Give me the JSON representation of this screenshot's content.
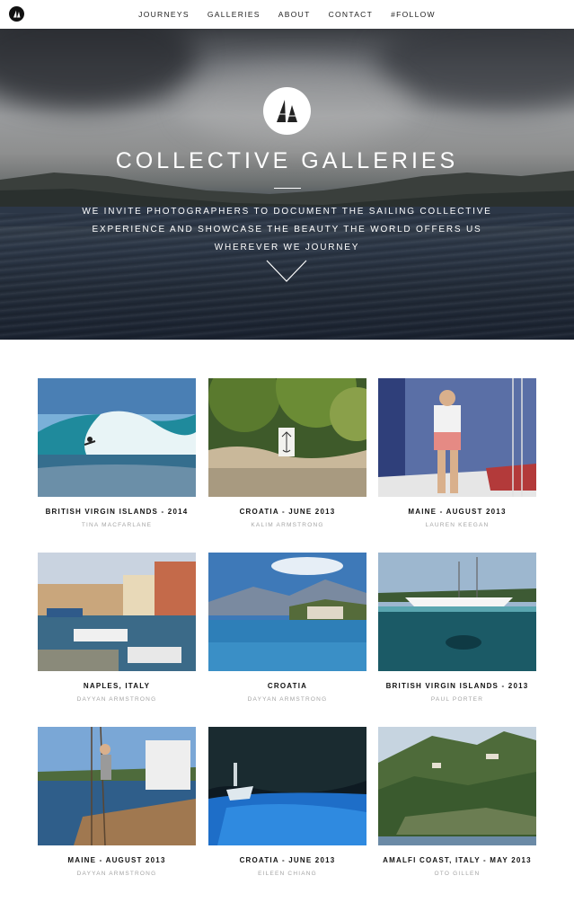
{
  "nav": {
    "logo": "sailing-collective-logo",
    "links": [
      "JOURNEYS",
      "GALLERIES",
      "ABOUT",
      "CONTACT",
      "#FOLLOW"
    ]
  },
  "hero": {
    "emblem": "sail-emblem",
    "title": "COLLECTIVE GALLERIES",
    "subtitle": "WE INVITE PHOTOGRAPHERS TO DOCUMENT THE SAILING COLLECTIVE EXPERIENCE AND SHOWCASE THE BEAUTY THE WORLD OFFERS US WHEREVER WE JOURNEY",
    "scroll_icon": "chevron-down-icon"
  },
  "galleries": [
    {
      "title": "BRITISH VIRGIN ISLANDS - 2014",
      "author": "TINA MACFARLANE"
    },
    {
      "title": "CROATIA - JUNE 2013",
      "author": "KALIM ARMSTRONG"
    },
    {
      "title": "MAINE - AUGUST 2013",
      "author": "LAUREN KEEGAN"
    },
    {
      "title": "NAPLES, ITALY",
      "author": "DAYYAN ARMSTRONG"
    },
    {
      "title": "CROATIA",
      "author": "DAYYAN ARMSTRONG"
    },
    {
      "title": "BRITISH VIRGIN ISLANDS - 2013",
      "author": "PAUL PORTER"
    },
    {
      "title": "MAINE - AUGUST 2013",
      "author": "DAYYAN ARMSTRONG"
    },
    {
      "title": "CROATIA - JUNE 2013",
      "author": "EILEEN CHIANG"
    },
    {
      "title": "AMALFI COAST, ITALY - MAY 2013",
      "author": "OTO GILLEN"
    }
  ]
}
